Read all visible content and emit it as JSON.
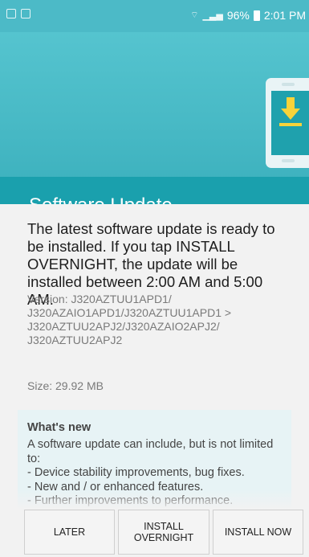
{
  "status_bar": {
    "battery_percent": "96%",
    "time": "2:01 PM"
  },
  "header": {
    "title": "Software Update"
  },
  "message": {
    "main": "The latest software update is ready to be installed. If you tap INSTALL OVERNIGHT, the update will be installed between 2:00 AM and 5:00 AM.",
    "version": "Version: J320AZTUU1APD1/ J320AZAIO1APD1/J320AZTUU1APD1 > J320AZTUU2APJ2/J320AZAIO2APJ2/ J320AZTUU2APJ2",
    "size": "Size: 29.92 MB"
  },
  "whats_new": {
    "title": "What's new",
    "body": "A software update can include, but is not limited to:\n - Device stability improvements, bug fixes.\n - New and / or enhanced features.\n - Further improvements to performance."
  },
  "buttons": {
    "later": "LATER",
    "install_overnight": "INSTALL OVERNIGHT",
    "install_now": "INSTALL NOW"
  },
  "colors": {
    "banner": "#46b8c4",
    "title_bar": "#1aa0ad",
    "download_icon": "#f7d33a"
  },
  "icons": {
    "status_left": [
      "notification-icon",
      "notification-icon"
    ],
    "status_right": [
      "wifi-icon",
      "signal-icon",
      "battery-icon"
    ],
    "banner": "phone-download-icon"
  }
}
